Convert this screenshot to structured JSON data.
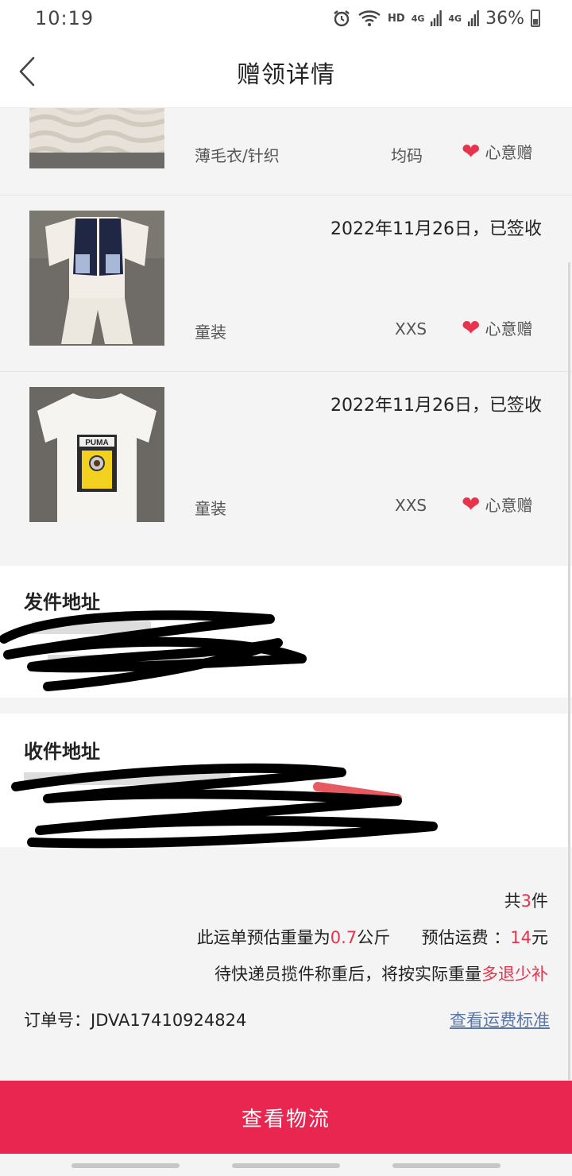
{
  "status_bar": {
    "time": "10:19",
    "network_hd": "HD",
    "signal_1": "4G",
    "signal_2": "4G",
    "battery": "36%"
  },
  "nav": {
    "title": "赠领详情",
    "back_icon": "chevron-left-icon"
  },
  "items": [
    {
      "date": "",
      "category": "薄毛衣/针织",
      "size": "均码",
      "tag": "心意赠",
      "tag_icon": "heart-icon"
    },
    {
      "date": "2022年11月26日，已签收",
      "category": "童装",
      "size": "XXS",
      "tag": "心意赠",
      "tag_icon": "heart-icon"
    },
    {
      "date": "2022年11月26日，已签收",
      "category": "童装",
      "size": "XXS",
      "tag": "心意赠",
      "tag_icon": "heart-icon",
      "shirt_logo": "PUMA"
    }
  ],
  "sender": {
    "title": "发件地址"
  },
  "receiver": {
    "title": "收件地址"
  },
  "summary": {
    "count_prefix": "共",
    "count": "3",
    "count_suffix": "件",
    "weight_prefix": "此运单预估重量为",
    "weight": "0.7",
    "weight_unit": "公斤",
    "fee_label": "预估运费 ：",
    "fee": "14",
    "fee_unit": "元",
    "note_prefix": "待快递员揽件称重后，将按实际重量",
    "note_highlight": "多退少补"
  },
  "order": {
    "label": "订单号：",
    "number": "JDVA17410924824",
    "fee_standard_link": "查看运费标准"
  },
  "actions": {
    "logistics_button": "查看物流"
  },
  "colors": {
    "accent": "#e8264f",
    "highlight": "#e8334c",
    "link": "#5a76a8",
    "background": "#f4f4f4"
  }
}
